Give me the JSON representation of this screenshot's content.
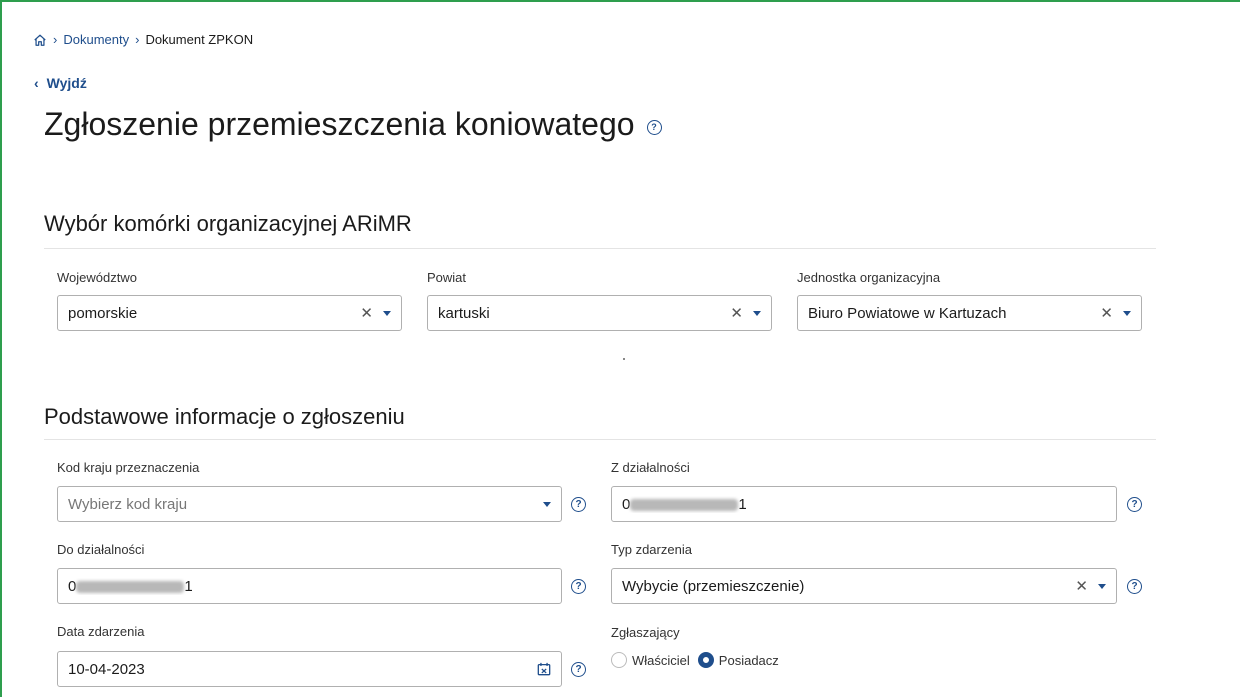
{
  "breadcrumb": {
    "items": [
      "Dokumenty",
      "Dokument ZPKON"
    ]
  },
  "back_label": "Wyjdź",
  "page_title": "Zgłoszenie przemieszczenia koniowatego",
  "section_org": {
    "title": "Wybór komórki organizacyjnej ARiMR",
    "wojewodztwo": {
      "label": "Województwo",
      "value": "pomorskie"
    },
    "powiat": {
      "label": "Powiat",
      "value": "kartuski"
    },
    "jednostka": {
      "label": "Jednostka organizacyjna",
      "value": "Biuro Powiatowe w Kartuzach"
    }
  },
  "section_basic": {
    "title": "Podstawowe informacje o zgłoszeniu",
    "kod_kraju": {
      "label": "Kod kraju przeznaczenia",
      "placeholder": "Wybierz kod kraju"
    },
    "z_dzialalnosci": {
      "label": "Z działalności",
      "value_start": "0",
      "value_end": "1"
    },
    "do_dzialalnosci": {
      "label": "Do działalności",
      "value_start": "0",
      "value_end": "1"
    },
    "typ_zdarzenia": {
      "label": "Typ zdarzenia",
      "value": "Wybycie (przemieszczenie)"
    },
    "data_zdarzenia": {
      "label": "Data zdarzenia",
      "value": "10-04-2023"
    },
    "zglaszajacy": {
      "label": "Zgłaszający",
      "options": [
        "Właściciel",
        "Posiadacz"
      ],
      "selected": "Posiadacz"
    }
  },
  "help_glyph": "?",
  "clear_glyph": "✕",
  "colors": {
    "accent": "#1f4e8c",
    "frame": "#2e9e4e"
  }
}
